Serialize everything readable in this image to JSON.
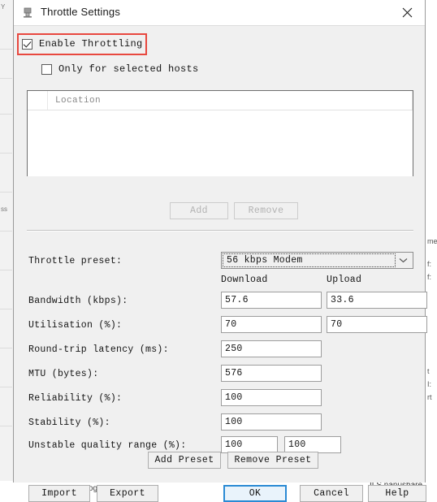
{
  "window": {
    "title": "Throttle Settings",
    "icon": "throttle-app-icon",
    "close_icon": "close-icon"
  },
  "options": {
    "enable_throttling": {
      "label": "Enable Throttling",
      "checked": true,
      "highlighted": true,
      "highlight_color": "#e8483f"
    },
    "only_selected_hosts": {
      "label": "Only for selected hosts",
      "checked": false
    }
  },
  "hosts_list": {
    "columns": [
      "",
      "Location"
    ],
    "rows": [],
    "add_button": {
      "label": "Add",
      "disabled": true
    },
    "remove_button": {
      "label": "Remove",
      "disabled": true
    }
  },
  "preset": {
    "label": "Throttle preset:",
    "selected": "56 kbps Modem",
    "dropdown_icon": "chevron-down-icon"
  },
  "columns": {
    "download": "Download",
    "upload": "Upload"
  },
  "fields": [
    {
      "label": "Bandwidth (kbps):",
      "download": "57.6",
      "upload": "33.6"
    },
    {
      "label": "Utilisation (%):",
      "download": "70",
      "upload": "70"
    },
    {
      "label": "Round-trip latency (ms):",
      "download": "250",
      "upload": null
    },
    {
      "label": "MTU (bytes):",
      "download": "576",
      "upload": null
    },
    {
      "label": "Reliability (%):",
      "download": "100",
      "upload": null
    },
    {
      "label": "Stability (%):",
      "download": "100",
      "upload": null
    },
    {
      "label": "Unstable quality range (%):",
      "download": "100",
      "upload": "100"
    }
  ],
  "preset_buttons": {
    "add": "Add Preset",
    "remove": "Remove Preset"
  },
  "dialog_buttons": {
    "import": "Import",
    "export": "Export",
    "ok": "OK",
    "cancel": "Cancel",
    "help": "Help",
    "default_button": "ok",
    "default_border_color": "#2a8ad4"
  },
  "background": {
    "left_text": "ss",
    "right_text_1": "me",
    "right_text_2": "f:",
    "right_text_3": "f:",
    "right_text_4": "t",
    "right_text_5": "I:",
    "right_text_6": "rt",
    "right_text_7": "ushare",
    "bottom_text": "www.sogou.com",
    "bottom_right_text": "ILS nanushare"
  }
}
